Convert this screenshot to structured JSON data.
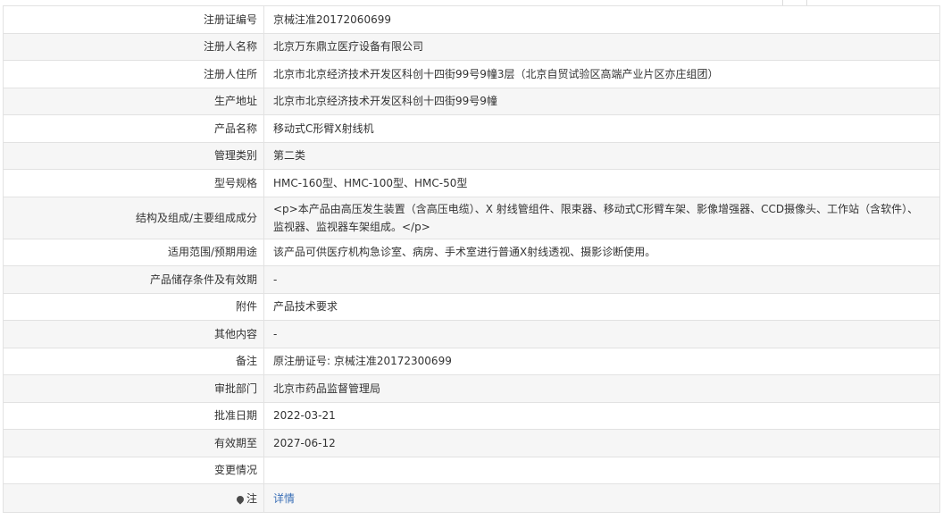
{
  "rows": [
    {
      "label": "注册证编号",
      "value": "京械注准20172060699"
    },
    {
      "label": "注册人名称",
      "value": "北京万东鼎立医疗设备有限公司"
    },
    {
      "label": "注册人住所",
      "value": "北京市北京经济技术开发区科创十四街99号9幢3层（北京自贸试验区高端产业片区亦庄组团）"
    },
    {
      "label": "生产地址",
      "value": "北京市北京经济技术开发区科创十四街99号9幢"
    },
    {
      "label": "产品名称",
      "value": "移动式C形臂X射线机"
    },
    {
      "label": "管理类别",
      "value": "第二类"
    },
    {
      "label": "型号规格",
      "value": "HMC-160型、HMC-100型、HMC-50型"
    },
    {
      "label": "结构及组成/主要组成成分",
      "value": "<p>本产品由高压发生装置（含高压电缆）、X 射线管组件、限束器、移动式C形臂车架、影像增强器、CCD摄像头、工作站（含软件）、监视器、监视器车架组成。</p>"
    },
    {
      "label": "适用范围/预期用途",
      "value": "该产品可供医疗机构急诊室、病房、手术室进行普通X射线透视、摄影诊断使用。"
    },
    {
      "label": "产品储存条件及有效期",
      "value": "-"
    },
    {
      "label": "附件",
      "value": "产品技术要求"
    },
    {
      "label": "其他内容",
      "value": "-"
    },
    {
      "label": "备注",
      "value": "原注册证号: 京械注准20172300699"
    },
    {
      "label": "审批部门",
      "value": "北京市药品监督管理局"
    },
    {
      "label": "批准日期",
      "value": "2022-03-21"
    },
    {
      "label": "有效期至",
      "value": "2027-06-12"
    },
    {
      "label": "变更情况",
      "value": ""
    }
  ],
  "note": {
    "label": "注",
    "icon": "location-pin-icon",
    "link_text": "详情"
  },
  "colors": {
    "link": "#3a6fb6",
    "alt_row_bg": "#f6f6f6",
    "border": "#e2e2e2"
  }
}
